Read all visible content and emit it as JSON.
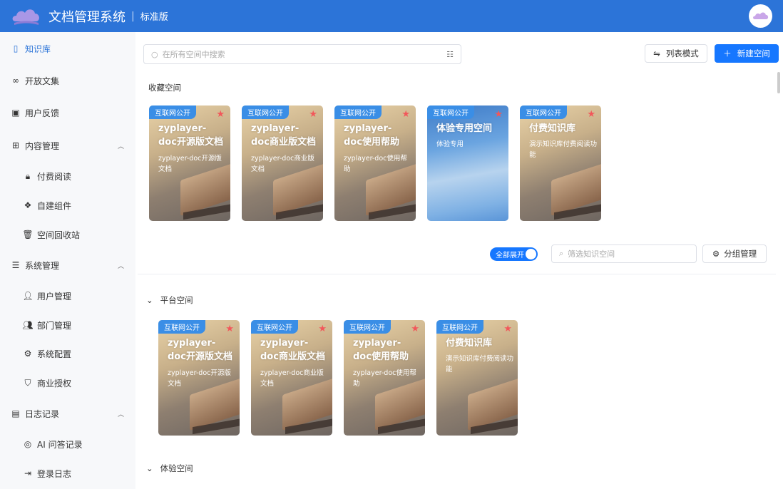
{
  "header": {
    "title": "文档管理系统",
    "edition": "标准版"
  },
  "sidebar": {
    "items": [
      {
        "label": "知识库",
        "icon": "notebook-icon",
        "active": true
      },
      {
        "label": "开放文集",
        "icon": "link-icon"
      },
      {
        "label": "用户反馈",
        "icon": "feedback-icon"
      },
      {
        "label": "内容管理",
        "icon": "grid-icon",
        "expanded": true,
        "children": [
          {
            "label": "付费阅读",
            "icon": "lock-icon"
          },
          {
            "label": "自建组件",
            "icon": "component-icon"
          },
          {
            "label": "空间回收站",
            "icon": "trash-icon"
          }
        ]
      },
      {
        "label": "系统管理",
        "icon": "sliders-icon",
        "expanded": true,
        "children": [
          {
            "label": "用户管理",
            "icon": "user-icon"
          },
          {
            "label": "部门管理",
            "icon": "users-icon"
          },
          {
            "label": "系统配置",
            "icon": "gear-icon"
          },
          {
            "label": "商业授权",
            "icon": "shield-icon"
          }
        ]
      },
      {
        "label": "日志记录",
        "icon": "log-icon",
        "expanded": true,
        "children": [
          {
            "label": "AI 问答记录",
            "icon": "ai-icon"
          },
          {
            "label": "登录日志",
            "icon": "login-icon"
          }
        ]
      }
    ]
  },
  "toolbar": {
    "search_placeholder": "在所有空间中搜索",
    "list_mode": "列表模式",
    "new_space": "新建空间"
  },
  "favorites": {
    "title": "收藏空间",
    "cards": [
      {
        "tag": "互联网公开",
        "title": "zyplayer-doc开源版文档",
        "desc": "zyplayer-doc开源版文档"
      },
      {
        "tag": "互联网公开",
        "title": "zyplayer-doc商业版文档",
        "desc": "zyplayer-doc商业版文档"
      },
      {
        "tag": "互联网公开",
        "title": "zyplayer-doc使用帮助",
        "desc": "zyplayer-doc使用帮助"
      },
      {
        "tag": "互联网公开",
        "title": "体验专用空间",
        "desc": "体验专用"
      },
      {
        "tag": "互联网公开",
        "title": "付费知识库",
        "desc": "演示知识库付费阅读功能"
      }
    ]
  },
  "controls": {
    "expand_all": "全部展开",
    "filter_placeholder": "筛选知识空间",
    "group_manage": "分组管理"
  },
  "groups": [
    {
      "title": "平台空间",
      "cards": [
        {
          "tag": "互联网公开",
          "title": "zyplayer-doc开源版文档",
          "desc": "zyplayer-doc开源版文档"
        },
        {
          "tag": "互联网公开",
          "title": "zyplayer-doc商业版文档",
          "desc": "zyplayer-doc商业版文档"
        },
        {
          "tag": "互联网公开",
          "title": "zyplayer-doc使用帮助",
          "desc": "zyplayer-doc使用帮助"
        },
        {
          "tag": "互联网公开",
          "title": "付费知识库",
          "desc": "演示知识库付费阅读功能"
        }
      ]
    },
    {
      "title": "体验空间",
      "cards": []
    }
  ]
}
